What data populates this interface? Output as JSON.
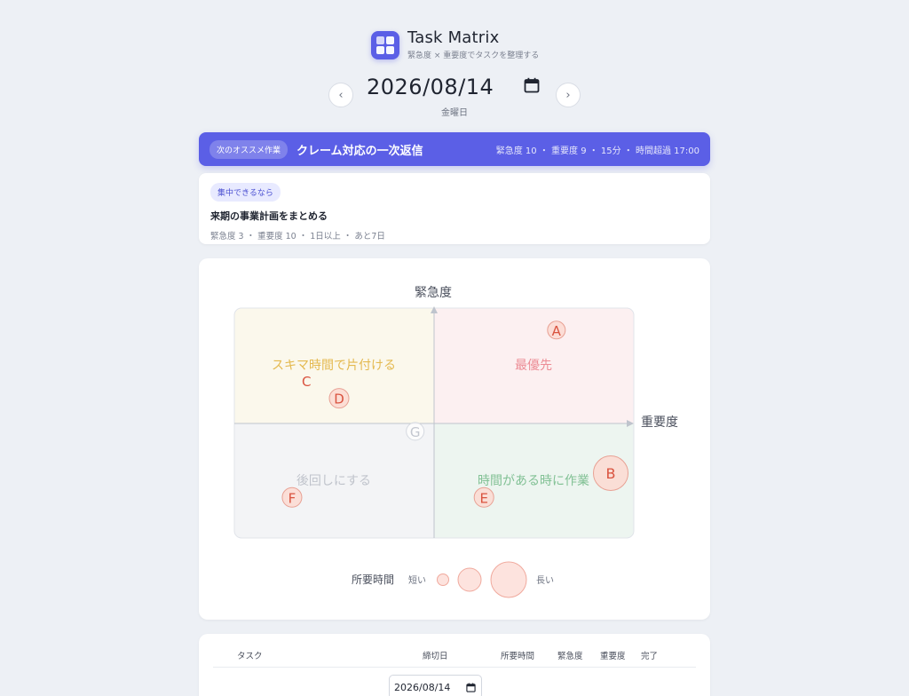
{
  "app": {
    "title": "Task Matrix",
    "subtitle": "緊急度 × 重要度でタスクを整理する",
    "logo_icon": "grid-icon",
    "accent": "#5b5fe6"
  },
  "date_nav": {
    "prev_label": "‹",
    "next_label": "›",
    "date": "2026/08/14",
    "weekday": "金曜日",
    "calendar_icon": "calendar-icon"
  },
  "recommend": {
    "badge": "次のオススメ作業",
    "title": "クレーム対応の一次返信",
    "meta": "緊急度 10 ・ 重要度 9 ・ 15分 ・ 時間超過 17:00"
  },
  "focus": {
    "badge": "集中できるなら",
    "title": "来期の事業計画をまとめる",
    "meta": "緊急度 3 ・ 重要度 10 ・ 1日以上 ・ あと7日"
  },
  "matrix": {
    "y_axis_label": "緊急度",
    "x_axis_label": "重要度",
    "quadrants": {
      "top_left": "スキマ時間で片付ける",
      "top_right": "最優先",
      "bottom_left": "後回しにする",
      "bottom_right": "時間がある時に作業"
    },
    "quadrant_colors": {
      "top_left": "#fbf8ec",
      "top_right": "#fcf0f1",
      "bottom_left": "#f3f4f6",
      "bottom_right": "#edf5f0"
    },
    "quadrant_label_colors": {
      "top_left": "#e4b94f",
      "top_right": "#ec8c95",
      "bottom_left": "#c0c4cc",
      "bottom_right": "#82c195"
    },
    "legend": {
      "title": "所要時間",
      "short": "短い",
      "long": "長い"
    },
    "tasks": [
      {
        "label": "A",
        "importance": 8.5,
        "urgency": 9.0,
        "size": 1
      },
      {
        "label": "B",
        "importance": 10.0,
        "urgency": 2.5,
        "size": 3
      },
      {
        "label": "C",
        "importance": 1.6,
        "urgency": 6.7,
        "size": 0
      },
      {
        "label": "D",
        "importance": 2.5,
        "urgency": 5.9,
        "size": 2
      },
      {
        "label": "E",
        "importance": 6.5,
        "urgency": 1.4,
        "size": 2
      },
      {
        "label": "F",
        "importance": 1.2,
        "urgency": 1.4,
        "size": 2
      },
      {
        "label": "G",
        "importance": 4.6,
        "urgency": 4.4,
        "size": 1,
        "muted": true
      }
    ]
  },
  "table": {
    "headers": {
      "task": "タスク",
      "deadline": "締切日",
      "duration": "所要時間",
      "urgency": "緊急度",
      "importance": "重要度",
      "done": "完了"
    },
    "first_row": {
      "deadline": "2026/08/14"
    }
  }
}
